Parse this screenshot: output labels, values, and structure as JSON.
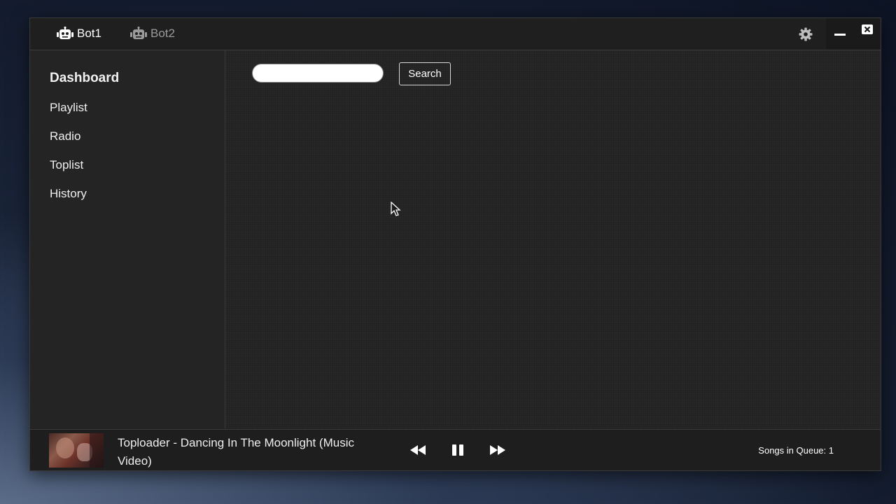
{
  "colors": {
    "window_bg": "#232323",
    "titlebar_bg": "#1f1f1f",
    "text": "#ffffff",
    "inactive_text": "#9a9a9a"
  },
  "titlebar": {
    "tabs": [
      {
        "label": "Bot1",
        "icon": "robot-icon",
        "active": true
      },
      {
        "label": "Bot2",
        "icon": "robot-icon",
        "active": false
      }
    ],
    "settings_icon": "gear-icon",
    "minimize_icon": "minimize-icon",
    "close_icon": "close-icon"
  },
  "sidebar": {
    "items": [
      {
        "label": "Dashboard",
        "active": true
      },
      {
        "label": "Playlist",
        "active": false
      },
      {
        "label": "Radio",
        "active": false
      },
      {
        "label": "Toplist",
        "active": false
      },
      {
        "label": "History",
        "active": false
      }
    ]
  },
  "search": {
    "value": "",
    "placeholder": "",
    "button_label": "Search"
  },
  "player": {
    "song_title": "Toploader - Dancing In The Moonlight (Music Video)",
    "controls": [
      "rewind-icon",
      "pause-icon",
      "fast-forward-icon"
    ],
    "queue_text": "Songs in Queue: 1"
  }
}
